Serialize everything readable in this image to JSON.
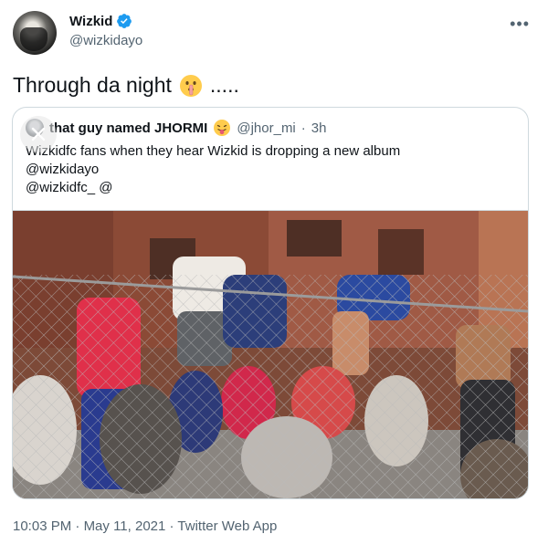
{
  "author": {
    "display_name": "Wizkid",
    "handle": "@wizkidayo"
  },
  "tweet": {
    "text": "Through da night",
    "trailing": ".....",
    "emoji_icon": "shushing-face-emoji"
  },
  "quoted_tweet": {
    "display_name": "that guy named JHORMI",
    "name_emoji_icon": "tongue-out-face-emoji",
    "handle": "@jhor_mi",
    "separator": "·",
    "time": "3h",
    "lines": [
      "Wizkidfc fans when they hear Wizkid is dropping a new album",
      "@wizkidayo",
      "@wizkidfc_ @"
    ]
  },
  "footer": {
    "time": "10:03 PM",
    "date": "May 11, 2021",
    "source": "Twitter Web App",
    "separator": "·"
  },
  "colors": {
    "verified_blue": "#1d9bf0",
    "secondary_text": "#536471",
    "border": "#cfd9de"
  }
}
